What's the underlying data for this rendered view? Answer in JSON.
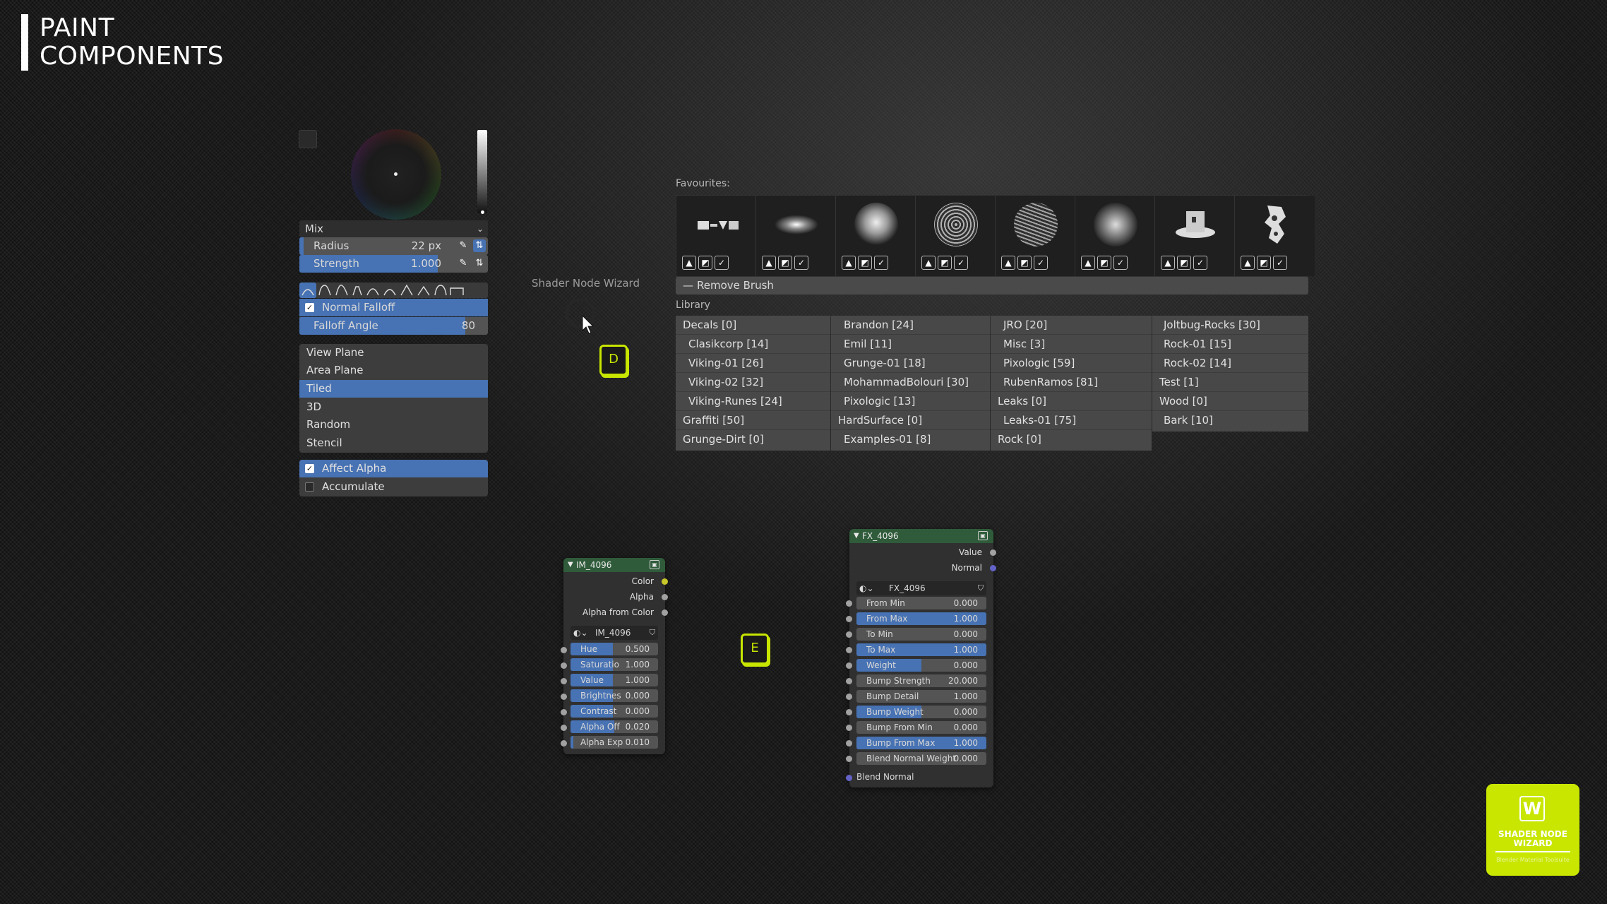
{
  "page": {
    "title_line1": "PAINT",
    "title_line2": "COMPONENTS"
  },
  "brush": {
    "blend_mode": "Mix",
    "radius_label": "Radius",
    "radius_value": "22 px",
    "strength_label": "Strength",
    "strength_value": "1.000",
    "normal_falloff_label": "Normal Falloff",
    "falloff_angle_label": "Falloff Angle",
    "falloff_angle_value": "80",
    "mapping_modes": [
      "View Plane",
      "Area Plane",
      "Tiled",
      "3D",
      "Random",
      "Stencil"
    ],
    "mapping_selected": "Tiled",
    "affect_alpha_label": "Affect Alpha",
    "accumulate_label": "Accumulate"
  },
  "wizard": {
    "label": "Shader Node Wizard",
    "key_d": "D",
    "key_e": "E"
  },
  "brushes": {
    "favourites_label": "Favourites:",
    "remove_label": "Remove Brush",
    "library_label": "Library",
    "library_columns": [
      [
        "Decals [0]",
        "Clasikcorp [14]",
        "Viking-01 [26]",
        "Viking-02 [32]",
        "Viking-Runes [24]",
        "Graffiti [50]",
        "Grunge-Dirt [0]"
      ],
      [
        "Brandon [24]",
        "Emil [11]",
        "Grunge-01 [18]",
        "MohammadBolouri [30]",
        "Pixologic [13]",
        "HardSurface [0]",
        "Examples-01 [8]"
      ],
      [
        "JRO [20]",
        "Misc [3]",
        "Pixologic [59]",
        "RubenRamos [81]",
        "Leaks [0]",
        "Leaks-01 [75]",
        "Rock [0]"
      ],
      [
        "Joltbug-Rocks [30]",
        "Rock-01 [15]",
        "Rock-02 [14]",
        "Test [1]",
        "Wood [0]",
        "Bark [10]"
      ]
    ]
  },
  "node_im": {
    "title": "IM_4096",
    "outputs": [
      "Color",
      "Alpha",
      "Alpha from Color"
    ],
    "image_name": "IM_4096",
    "fields": [
      {
        "label": "Hue",
        "value": "0.500"
      },
      {
        "label": "Saturatio",
        "value": "1.000"
      },
      {
        "label": "Value",
        "value": "1.000"
      },
      {
        "label": "Brightnes",
        "value": "0.000"
      },
      {
        "label": "Contrast",
        "value": "0.000"
      },
      {
        "label": "Alpha Off",
        "value": "0.020"
      },
      {
        "label": "Alpha Exp",
        "value": "0.010"
      }
    ]
  },
  "node_fx": {
    "title": "FX_4096",
    "outputs": [
      "Value",
      "Normal"
    ],
    "image_name": "FX_4096",
    "fields": [
      {
        "label": "From Min",
        "value": "0.000",
        "fill": 0
      },
      {
        "label": "From Max",
        "value": "1.000",
        "fill": 1
      },
      {
        "label": "To Min",
        "value": "0.000",
        "fill": 0
      },
      {
        "label": "To Max",
        "value": "1.000",
        "fill": 1
      },
      {
        "label": "Weight",
        "value": "0.000",
        "fill": 0.5
      },
      {
        "label": "Bump Strength",
        "value": "20.000",
        "fill": 0
      },
      {
        "label": "Bump Detail",
        "value": "1.000",
        "fill": 0
      },
      {
        "label": "Bump Weight",
        "value": "0.000",
        "fill": 0.5
      },
      {
        "label": "Bump From Min",
        "value": "0.000",
        "fill": 0
      },
      {
        "label": "Bump From Max",
        "value": "1.000",
        "fill": 1
      },
      {
        "label": "Blend Normal Weight",
        "value": "0.000",
        "fill": 0
      }
    ],
    "input_label": "Blend Normal"
  },
  "logo": {
    "letter": "W",
    "title": "SHADER NODE WIZARD",
    "subtitle": "Blender Material Toolsuite"
  },
  "colors": {
    "accent": "#c8e600",
    "selection": "#4772b3"
  }
}
